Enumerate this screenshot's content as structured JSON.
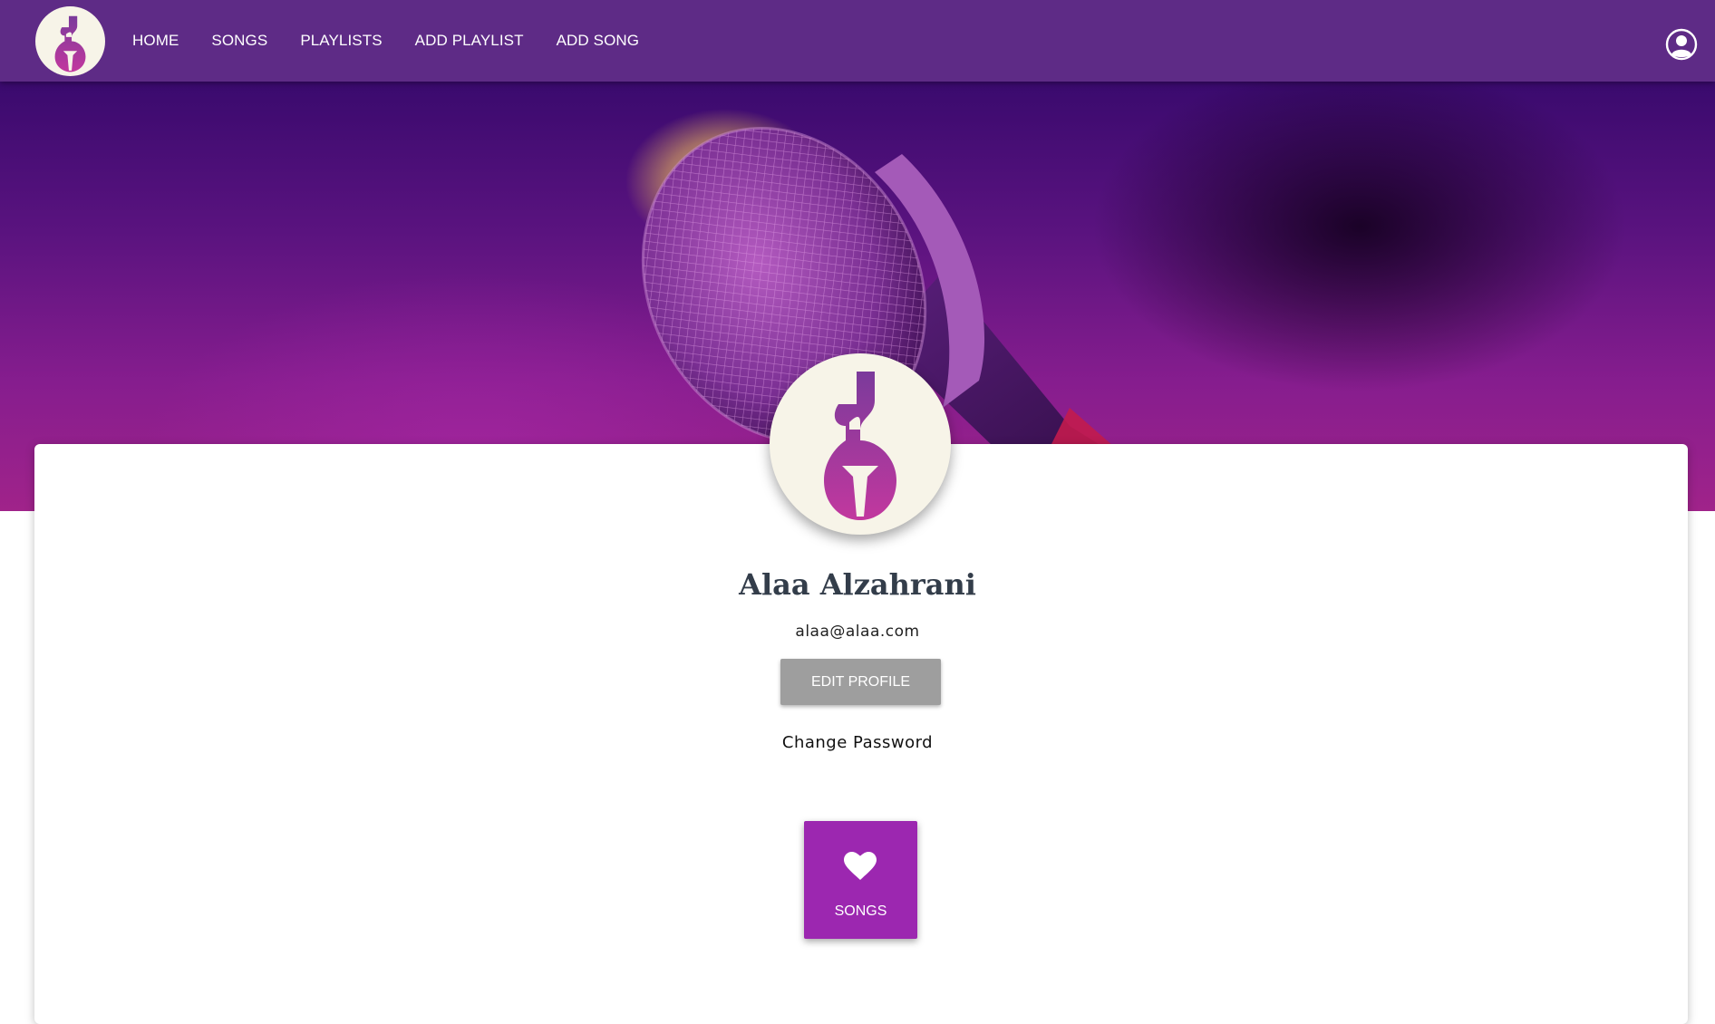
{
  "nav": {
    "links": [
      "HOME",
      "SONGS",
      "PLAYLISTS",
      "ADD PLAYLIST",
      "ADD SONG"
    ],
    "logo_icon": "music-logo-icon",
    "account_icon": "account-circle-icon"
  },
  "hero": {
    "image": "microphone-photo"
  },
  "profile": {
    "name": "Alaa Alzahrani",
    "email": "alaa@alaa.com",
    "edit_label": "EDIT PROFILE",
    "change_password_label": "Change Password",
    "songs_tile_label": "SONGS",
    "songs_tile_icon": "heart-icon"
  },
  "colors": {
    "navbar": "#5e2b86",
    "tile": "#9c27b0",
    "edit_button": "#9e9e9e",
    "name_text": "#333d4a"
  }
}
